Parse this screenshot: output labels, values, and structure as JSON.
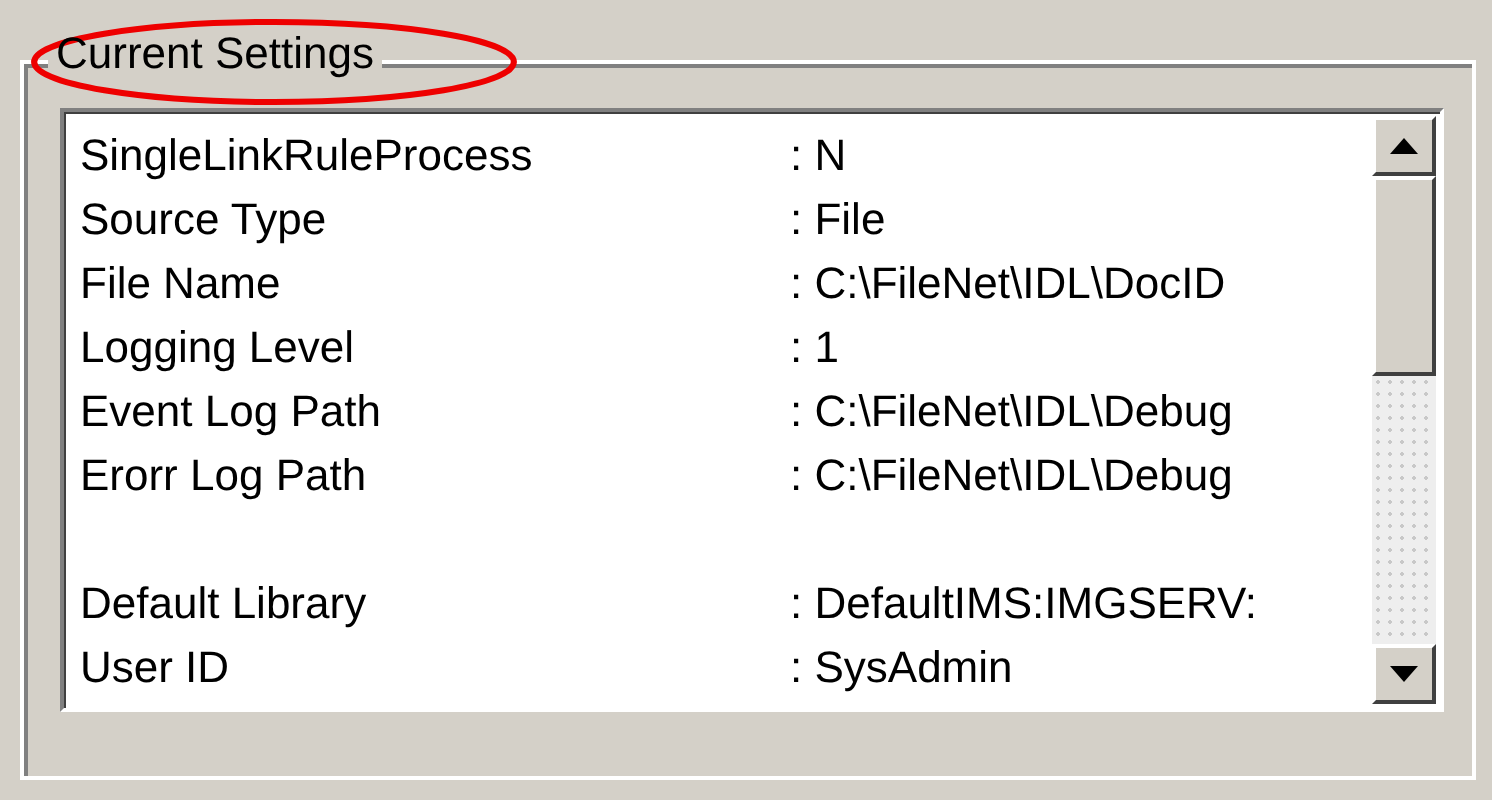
{
  "group": {
    "title": "Current Settings",
    "highlight": {
      "kind": "ellipse"
    }
  },
  "settings": [
    {
      "kind": "setting",
      "label": "SingleLinkRuleProcess",
      "value": ": N"
    },
    {
      "kind": "setting",
      "label": "Source Type",
      "value": ": File"
    },
    {
      "kind": "setting",
      "label": "File Name",
      "value": ": C:\\FileNet\\IDL\\DocID"
    },
    {
      "kind": "setting",
      "label": "Logging Level",
      "value": ": 1"
    },
    {
      "kind": "setting",
      "label": "Event Log Path",
      "value": ": C:\\FileNet\\IDL\\Debug"
    },
    {
      "kind": "setting",
      "label": "Erorr Log Path",
      "value": ": C:\\FileNet\\IDL\\Debug"
    },
    {
      "kind": "blank"
    },
    {
      "kind": "setting",
      "label": "Default Library",
      "value": ": DefaultIMS:IMGSERV:"
    },
    {
      "kind": "setting",
      "label": "User ID",
      "value": ": SysAdmin"
    }
  ]
}
